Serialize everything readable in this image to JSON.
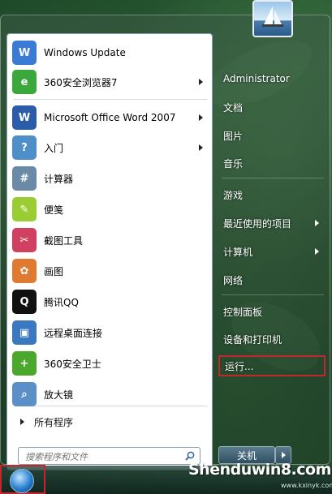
{
  "start_menu": {
    "programs": [
      {
        "label": "Windows Update",
        "icon": "windows-update-icon",
        "color": "#3a7bd5",
        "glyph": "W",
        "has_submenu": false
      },
      {
        "label": "360安全浏览器7",
        "icon": "360-browser-icon",
        "color": "#3aa83a",
        "glyph": "e",
        "has_submenu": true
      },
      {
        "label": "Microsoft Office Word 2007",
        "icon": "word-icon",
        "color": "#2b5caa",
        "glyph": "W",
        "has_submenu": true
      },
      {
        "label": "入门",
        "icon": "getting-started-icon",
        "color": "#4f8fc9",
        "glyph": "?",
        "has_submenu": true
      },
      {
        "label": "计算器",
        "icon": "calculator-icon",
        "color": "#6b8aa8",
        "glyph": "#",
        "has_submenu": false
      },
      {
        "label": "便笺",
        "icon": "sticky-notes-icon",
        "color": "#9acd32",
        "glyph": "✎",
        "has_submenu": false
      },
      {
        "label": "截图工具",
        "icon": "snipping-tool-icon",
        "color": "#d04060",
        "glyph": "✂",
        "has_submenu": false
      },
      {
        "label": "画图",
        "icon": "paint-icon",
        "color": "#e07a30",
        "glyph": "✿",
        "has_submenu": false
      },
      {
        "label": "腾讯QQ",
        "icon": "qq-icon",
        "color": "#111111",
        "glyph": "Q",
        "has_submenu": false
      },
      {
        "label": "远程桌面连接",
        "icon": "remote-desktop-icon",
        "color": "#3a78c0",
        "glyph": "▣",
        "has_submenu": false
      },
      {
        "label": "360安全卫士",
        "icon": "360-safeguard-icon",
        "color": "#4aa92a",
        "glyph": "+",
        "has_submenu": false
      },
      {
        "label": "放大镜",
        "icon": "magnifier-icon",
        "color": "#5a8fc8",
        "glyph": "⌕",
        "has_submenu": false
      }
    ],
    "all_programs_label": "所有程序",
    "search_placeholder": "搜索程序和文件"
  },
  "right_pane": {
    "user": "Administrator",
    "items": [
      {
        "label": "文档",
        "has_submenu": false
      },
      {
        "label": "图片",
        "has_submenu": false
      },
      {
        "label": "音乐",
        "has_submenu": false
      },
      {
        "label": "游戏",
        "has_submenu": false
      },
      {
        "label": "最近使用的项目",
        "has_submenu": true
      },
      {
        "label": "计算机",
        "has_submenu": true
      },
      {
        "label": "网络",
        "has_submenu": false
      },
      {
        "label": "控制面板",
        "has_submenu": false
      },
      {
        "label": "设备和打印机",
        "has_submenu": false
      },
      {
        "label": "运行...",
        "has_submenu": false,
        "highlighted": true
      }
    ],
    "shutdown_label": "关机"
  },
  "watermark": {
    "text": "Shenduwin8.com",
    "sub": "www.kxinyk.com"
  },
  "colors": {
    "highlight": "#c4262e",
    "accent": "#2a7fd0"
  }
}
